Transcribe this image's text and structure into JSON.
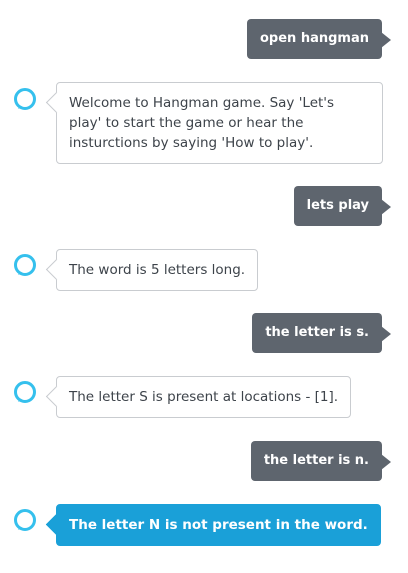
{
  "messages": [
    {
      "role": "user",
      "text": "open hangman"
    },
    {
      "role": "bot",
      "text": "Welcome to Hangman game. Say 'Let's play' to start the game or hear the insturctions by saying 'How to play'."
    },
    {
      "role": "user",
      "text": "lets play"
    },
    {
      "role": "bot",
      "text": "The word is 5 letters long."
    },
    {
      "role": "user",
      "text": "the letter is s."
    },
    {
      "role": "bot",
      "text": "The letter S is present at locations - [1]."
    },
    {
      "role": "user",
      "text": "the letter is n."
    },
    {
      "role": "bot",
      "text": "The letter N is not present in the word."
    }
  ],
  "colors": {
    "user_bubble": "#5e656e",
    "bot_border": "#c9ccd0",
    "active_bot": "#1aa0d8",
    "alexa_ring": "#35c0ed"
  },
  "icons": {
    "assistant": "alexa-ring-icon"
  }
}
